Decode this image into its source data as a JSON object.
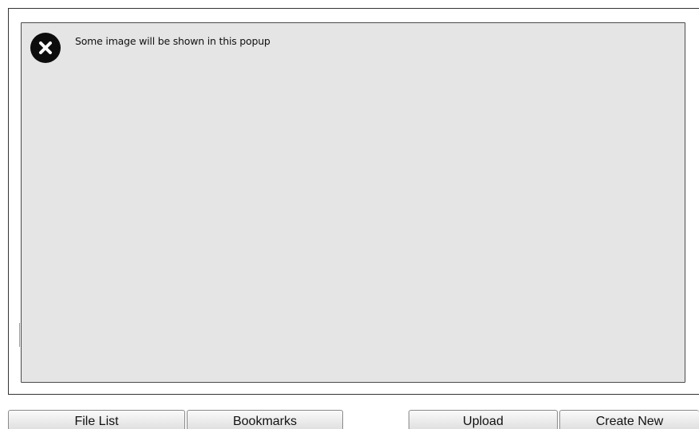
{
  "popup": {
    "message": "Some image  will be shown in this popup",
    "close_icon": "close-icon"
  },
  "toolbar": {
    "file_list_label": "File List",
    "bookmarks_label": "Bookmarks",
    "upload_label": "Upload",
    "create_new_label": "Create New"
  },
  "colors": {
    "popup_background": "#e5e5e5",
    "close_button": "#0d0d0d",
    "button_gradient_top": "#fafafa",
    "button_gradient_bottom": "#dedede"
  }
}
